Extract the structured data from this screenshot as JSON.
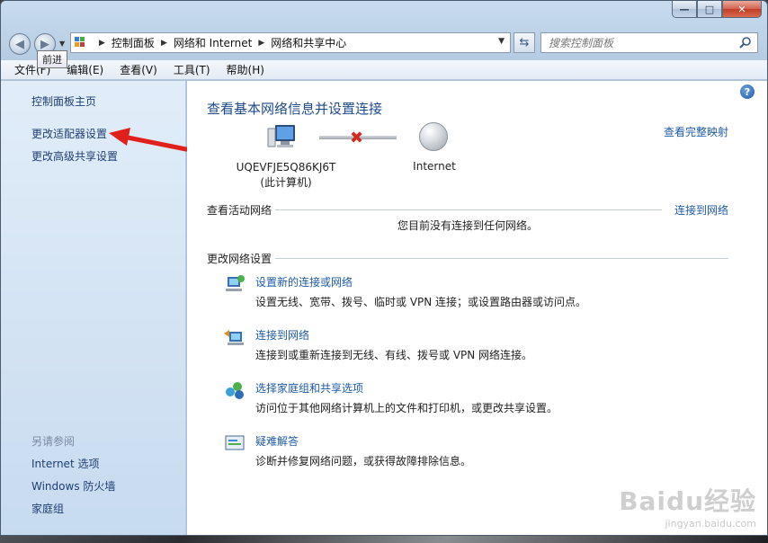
{
  "window": {
    "caption": {
      "minimize": "—",
      "maximize": "□",
      "close": "✕"
    }
  },
  "nav": {
    "back_icon": "back-arrow-icon",
    "forward_icon": "forward-arrow-icon",
    "tooltip": "前进",
    "breadcrumbs": [
      "控制面板",
      "网络和 Internet",
      "网络和共享中心"
    ],
    "search_placeholder": "搜索控制面板"
  },
  "menu": [
    "文件(F)",
    "编辑(E)",
    "查看(V)",
    "工具(T)",
    "帮助(H)"
  ],
  "sidebar": {
    "links": [
      "控制面板主页",
      "更改适配器设置",
      "更改高级共享设置"
    ],
    "see_also_heading": "另请参阅",
    "see_also": [
      "Internet 选项",
      "Windows 防火墙",
      "家庭组"
    ]
  },
  "main": {
    "title": "查看基本网络信息并设置连接",
    "map_link": "查看完整映射",
    "pc_name": "UQEVFJE5Q86KJ6T",
    "pc_sub": "(此计算机)",
    "internet": "Internet",
    "active_head": "查看活动网络",
    "active_link": "连接到网络",
    "no_connection": "您目前没有连接到任何网络。",
    "change_head": "更改网络设置",
    "tasks": [
      {
        "link": "设置新的连接或网络",
        "desc": "设置无线、宽带、拨号、临时或 VPN 连接；或设置路由器或访问点。"
      },
      {
        "link": "连接到网络",
        "desc": "连接到或重新连接到无线、有线、拨号或 VPN 网络连接。"
      },
      {
        "link": "选择家庭组和共享选项",
        "desc": "访问位于其他网络计算机上的文件和打印机，或更改共享设置。"
      },
      {
        "link": "疑难解答",
        "desc": "诊断并修复网络问题，或获得故障排除信息。"
      }
    ]
  },
  "watermark": {
    "brand": "Baidu经验",
    "url": "jingyan.baidu.com"
  },
  "colors": {
    "link": "#1e5aa8",
    "title": "#1e4a8c",
    "arrow": "#e0201a"
  }
}
